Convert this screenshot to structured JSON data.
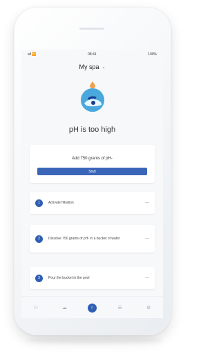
{
  "status_bar": {
    "time": "08:41",
    "carrier": "all 🛜",
    "battery": "100%"
  },
  "header": {
    "title": "My spa",
    "chevron_icon": "chevron-down-icon"
  },
  "status": {
    "icon": "water-drop-icon",
    "headline": "pH is too high"
  },
  "action": {
    "instruction": "Add 750 grams of pH-",
    "button": "Start"
  },
  "steps": [
    {
      "number": "1",
      "text": "Activate filtration"
    },
    {
      "number": "2",
      "text": "Dissolve 750 grams of pH- in a bucket of water"
    },
    {
      "number": "3",
      "text": "Pour the bucket in the pool"
    }
  ],
  "tabbar": {
    "items": [
      "dashboard-icon",
      "cloud-icon",
      "home-icon",
      "list-icon",
      "settings-icon"
    ],
    "active_index": 2
  }
}
